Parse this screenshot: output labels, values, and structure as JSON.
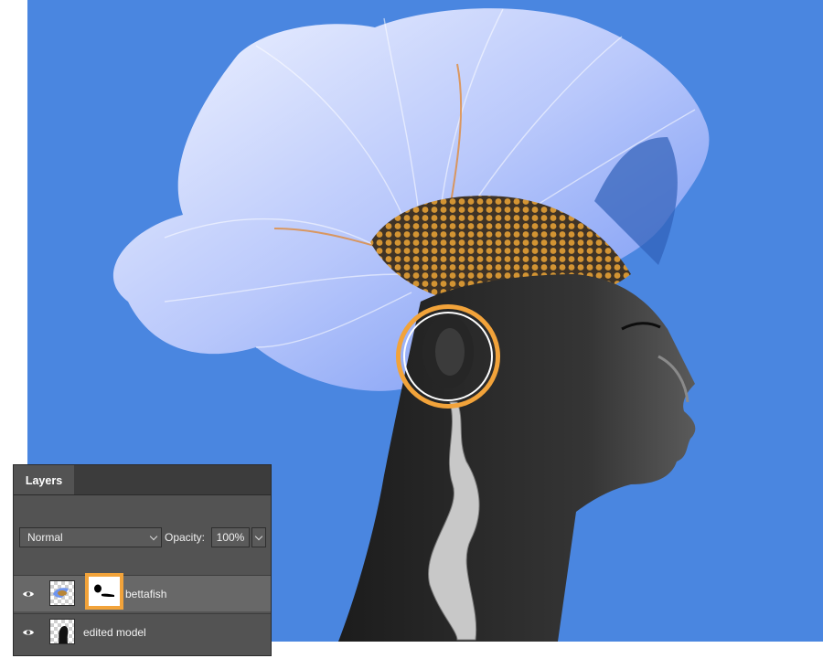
{
  "panel": {
    "tab_label": "Layers",
    "blend_mode": "Normal",
    "opacity_label": "Opacity:",
    "opacity_value": "100%"
  },
  "layers": [
    {
      "name": "bettafish",
      "visible": true,
      "has_mask": true,
      "selected": true
    },
    {
      "name": "edited model",
      "visible": true,
      "has_mask": false,
      "selected": false
    }
  ],
  "colors": {
    "canvas_background": "#4a86e0",
    "highlight": "#f2a33a",
    "panel_background": "#535353"
  },
  "icons": [
    "eye-icon",
    "chain-link-icon",
    "chevron-down-icon"
  ]
}
